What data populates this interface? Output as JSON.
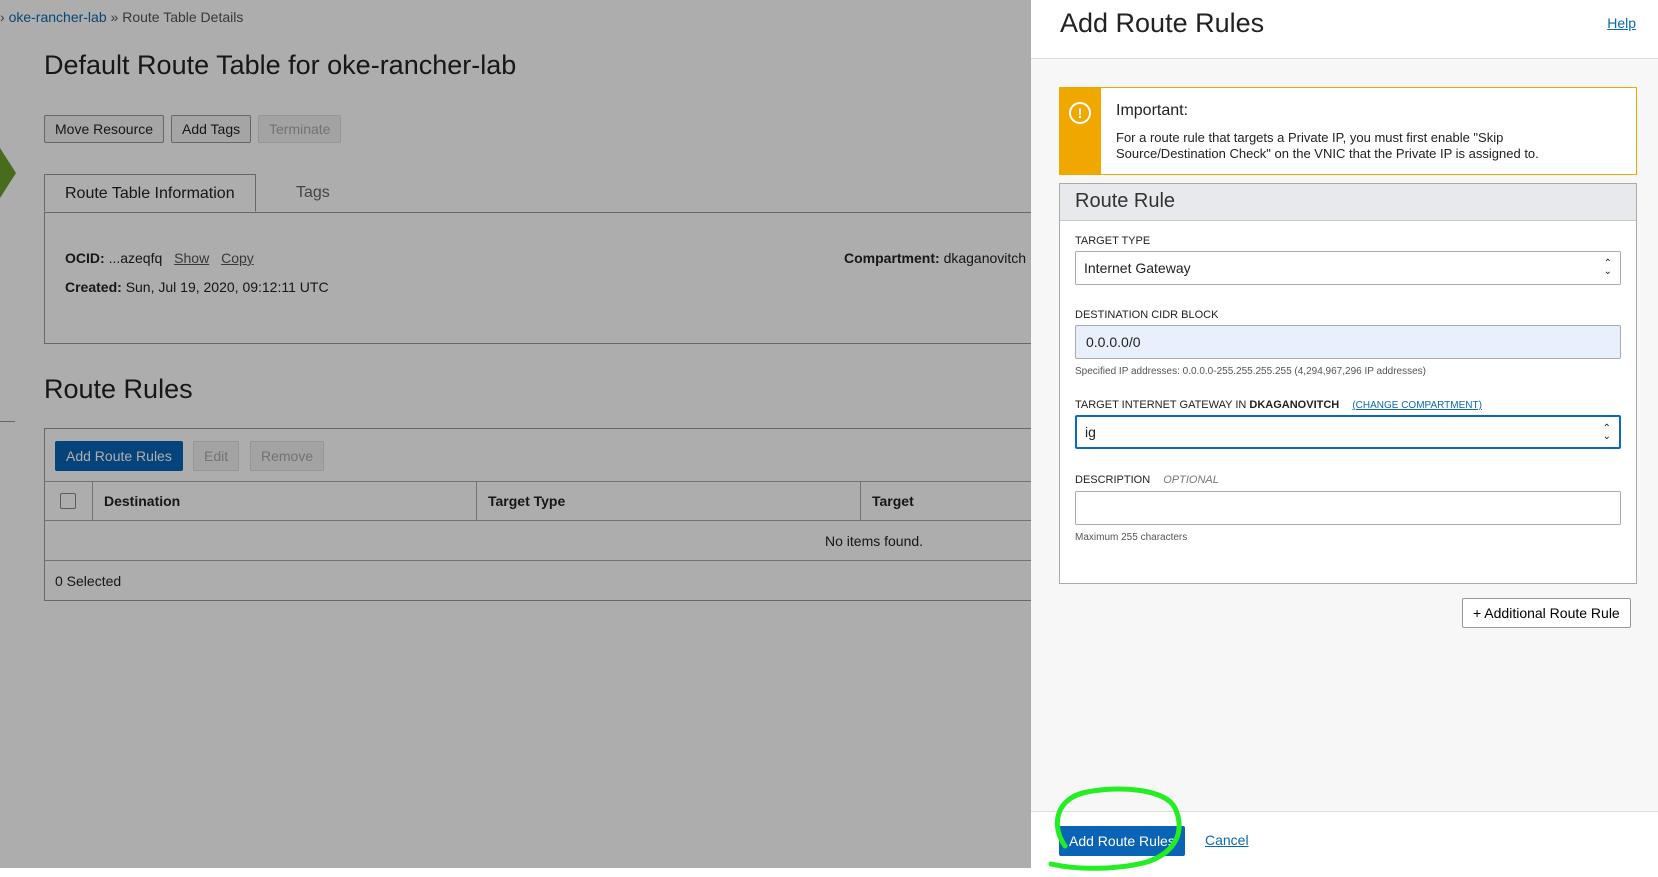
{
  "breadcrumb": {
    "sep0": "›",
    "link": "oke-rancher-lab",
    "sep1": "»",
    "current": "Route Table Details"
  },
  "page": {
    "title": "Default Route Table for oke-rancher-lab",
    "actions": {
      "move": "Move Resource",
      "tags": "Add Tags",
      "terminate": "Terminate"
    },
    "tabs": {
      "info": "Route Table Information",
      "tags": "Tags"
    },
    "info": {
      "ocid_label": "OCID:",
      "ocid_value": "...azeqfq",
      "show": "Show",
      "copy": "Copy",
      "created_label": "Created:",
      "created_value": "Sun, Jul 19, 2020, 09:12:11 UTC",
      "compartment_label": "Compartment:",
      "compartment_value": "dkaganovitch"
    }
  },
  "rules": {
    "title": "Route Rules",
    "add": "Add Route Rules",
    "edit": "Edit",
    "remove": "Remove",
    "columns": {
      "destination": "Destination",
      "target_type": "Target Type",
      "target": "Target"
    },
    "empty": "No items found.",
    "selected": "0 Selected"
  },
  "panel": {
    "title": "Add Route Rules",
    "help": "Help",
    "alert": {
      "icon": "!",
      "title": "Important:",
      "text": "For a route rule that targets a Private IP, you must first enable \"Skip Source/Destination Check\" on the VNIC that the Private IP is assigned to."
    },
    "rule": {
      "heading": "Route Rule",
      "target_type_label": "TARGET TYPE",
      "target_type_value": "Internet Gateway",
      "cidr_label": "DESTINATION CIDR BLOCK",
      "cidr_value": "0.0.0.0/0",
      "cidr_hint": "Specified IP addresses: 0.0.0.0-255.255.255.255 (4,294,967,296 IP addresses)",
      "gateway_label_prefix": "TARGET INTERNET GATEWAY IN",
      "gateway_label_compartment": "DKAGANOVITCH",
      "change_compartment": "(CHANGE COMPARTMENT)",
      "gateway_value": "ig",
      "description_label": "DESCRIPTION",
      "description_optional": "OPTIONAL",
      "description_value": "",
      "description_hint": "Maximum 255 characters"
    },
    "additional_rule": "+ Additional Route Rule",
    "footer": {
      "submit": "Add Route Rules",
      "cancel": "Cancel"
    }
  },
  "colors": {
    "accent": "#0a64b6",
    "warning": "#f0a800",
    "highlight": "#22ee22",
    "overlay": "rgba(0,0,0,0.32)"
  },
  "icons": {
    "alert": "exclamation-circle-icon",
    "select_chevron": "chevron-up-down-icon",
    "nav_arrow": "arrow-right-icon"
  }
}
